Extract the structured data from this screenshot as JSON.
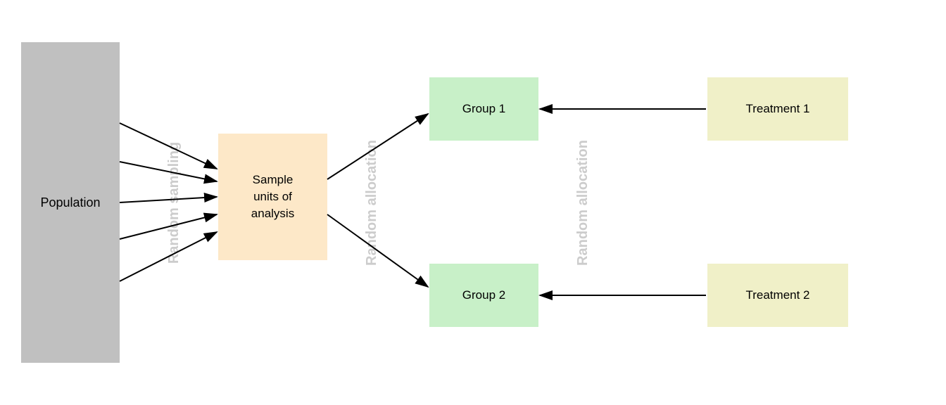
{
  "population": {
    "label": "Population"
  },
  "random_sampling": {
    "label": "Random sampling"
  },
  "sample": {
    "line1": "Sample",
    "line2": "units of",
    "line3": "analysis"
  },
  "random_allocation_mid": {
    "label": "Random allocation"
  },
  "random_allocation_right": {
    "label": "Random allocation"
  },
  "group1": {
    "label": "Group 1"
  },
  "group2": {
    "label": "Group 2"
  },
  "treatment1": {
    "label": "Treatment 1"
  },
  "treatment2": {
    "label": "Treatment 2"
  }
}
